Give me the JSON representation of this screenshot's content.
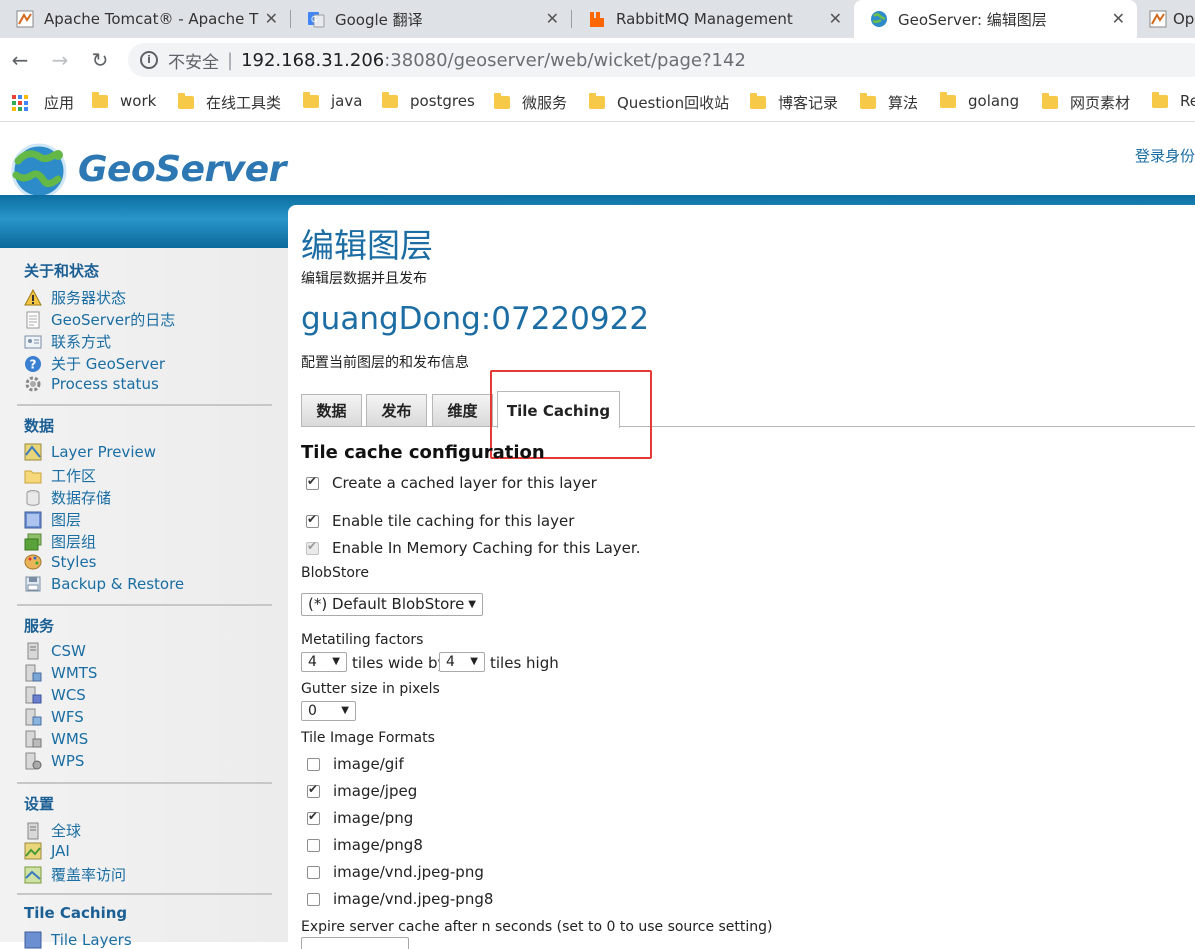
{
  "browser": {
    "tabs": [
      {
        "label": "Apache Tomcat® - Apache T",
        "icon": "tomcat-icon"
      },
      {
        "label": "Google 翻译",
        "icon": "google-translate-icon"
      },
      {
        "label": "RabbitMQ Management",
        "icon": "rabbitmq-icon"
      },
      {
        "label": "GeoServer: 编辑图层",
        "icon": "geoserver-icon"
      },
      {
        "label": "Op",
        "icon": "tomcat-icon"
      }
    ],
    "tab_close": "✕",
    "address": {
      "security": "不安全",
      "separator": "|",
      "host": "192.168.31.206",
      "rest": ":38080/geoserver/web/wicket/page?142"
    },
    "bookmarks": [
      "应用",
      "work",
      "在线工具类",
      "java",
      "postgres",
      "微服务",
      "Question回收站",
      "博客记录",
      "算法",
      "golang",
      "网页素材",
      "Re"
    ]
  },
  "header": {
    "logo_text": "GeoServer",
    "login_text": "登录身份"
  },
  "sidebar": {
    "sections": [
      {
        "title": "关于和状态",
        "items": [
          "服务器状态",
          "GeoServer的日志",
          "联系方式",
          "关于 GeoServer",
          "Process status"
        ]
      },
      {
        "title": "数据",
        "items": [
          "Layer Preview",
          "工作区",
          "数据存储",
          "图层",
          "图层组",
          "Styles",
          "Backup & Restore"
        ]
      },
      {
        "title": "服务",
        "items": [
          "CSW",
          "WMTS",
          "WCS",
          "WFS",
          "WMS",
          "WPS"
        ]
      },
      {
        "title": "设置",
        "items": [
          "全球",
          "JAI",
          "覆盖率访问"
        ]
      },
      {
        "title": "Tile Caching",
        "items": [
          "Tile Layers"
        ]
      }
    ]
  },
  "content": {
    "title": "编辑图层",
    "subtitle": "编辑层数据并且发布",
    "layer_name": "guangDong:07220922",
    "layer_desc": "配置当前图层的和发布信息",
    "tabs": [
      "数据",
      "发布",
      "维度",
      "Tile Caching"
    ],
    "active_tab": "Tile Caching",
    "section_title": "Tile cache configuration",
    "create_cached_layer": {
      "label": "Create a cached layer for this layer",
      "checked": true
    },
    "enable_tile_caching": {
      "label": "Enable tile caching for this layer",
      "checked": true
    },
    "enable_memory_caching": {
      "label": "Enable In Memory Caching for this Layer.",
      "checked": true,
      "disabled": true
    },
    "blobstore_label": "BlobStore",
    "blobstore_value": "(*) Default BlobStore",
    "metatiling_label": "Metatiling factors",
    "metatiling_wide": "4",
    "tiles_wide_by": "tiles wide by",
    "metatiling_high": "4",
    "tiles_high": "tiles high",
    "gutter_label": "Gutter size in pixels",
    "gutter_value": "0",
    "formats_label": "Tile Image Formats",
    "formats": [
      {
        "name": "image/gif",
        "checked": false
      },
      {
        "name": "image/jpeg",
        "checked": true
      },
      {
        "name": "image/png",
        "checked": true
      },
      {
        "name": "image/png8",
        "checked": false
      },
      {
        "name": "image/vnd.jpeg-png",
        "checked": false
      },
      {
        "name": "image/vnd.jpeg-png8",
        "checked": false
      }
    ],
    "expire_label": "Expire server cache after n seconds (set to 0 to use source setting)"
  },
  "colors": {
    "accent": "#1b6da4",
    "highlight": "#e53935",
    "band": "#1b82b7"
  }
}
